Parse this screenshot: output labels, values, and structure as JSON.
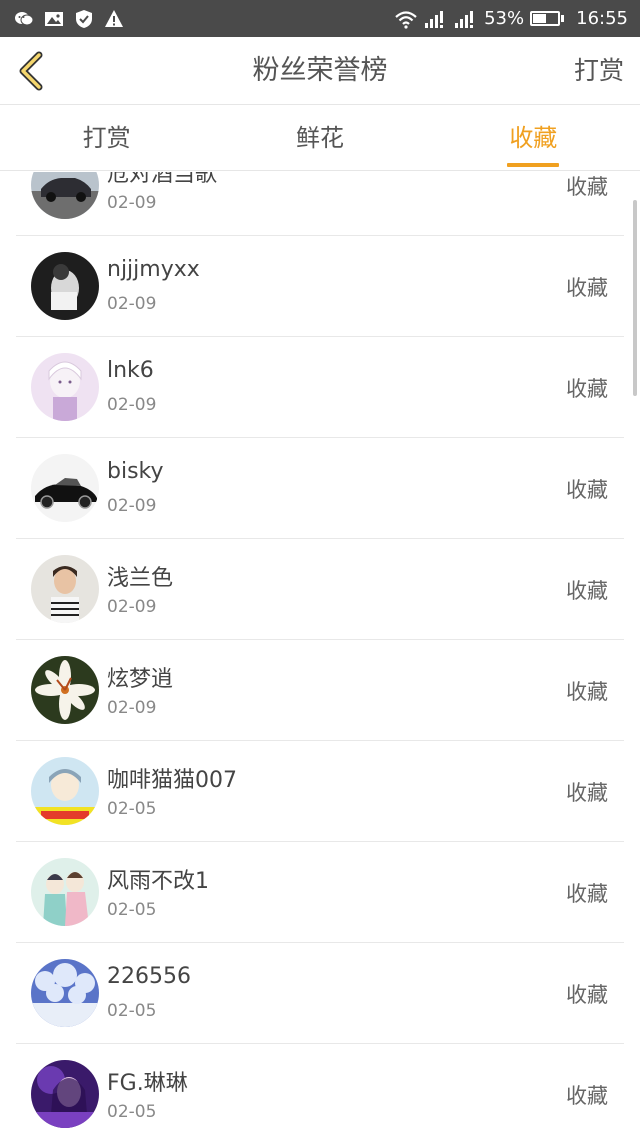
{
  "status_bar": {
    "battery": "53%",
    "battery_level": 0.53,
    "time": "16:55",
    "icons_left": [
      "wechat-icon",
      "image-icon",
      "shield-icon",
      "warning-icon"
    ],
    "icons_right": [
      "wifi-icon",
      "signal-icon",
      "signal-icon",
      "battery-icon"
    ]
  },
  "header": {
    "title": "粉丝荣誉榜",
    "right_action": "打赏"
  },
  "tabs": [
    {
      "label": "打赏",
      "active": false
    },
    {
      "label": "鲜花",
      "active": false
    },
    {
      "label": "收藏",
      "active": true
    }
  ],
  "colors": {
    "accent": "#f0a020",
    "status_bar": "#4a4a4a",
    "text": "#555555"
  },
  "list": [
    {
      "name": "危对酒当歌",
      "date": "02-09",
      "action": "收藏",
      "avatar": "car-photo"
    },
    {
      "name": "njjjmyxx",
      "date": "02-09",
      "action": "收藏",
      "avatar": "dark-photo"
    },
    {
      "name": "lnk6",
      "date": "02-09",
      "action": "收藏",
      "avatar": "anime-portrait"
    },
    {
      "name": "bisky",
      "date": "02-09",
      "action": "收藏",
      "avatar": "black-car"
    },
    {
      "name": "浅兰色",
      "date": "02-09",
      "action": "收藏",
      "avatar": "person-photo"
    },
    {
      "name": "炫梦逍",
      "date": "02-09",
      "action": "收藏",
      "avatar": "lily-flower"
    },
    {
      "name": "咖啡猫猫007",
      "date": "02-05",
      "action": "收藏",
      "avatar": "cartoon-photo"
    },
    {
      "name": "风雨不改1",
      "date": "02-05",
      "action": "收藏",
      "avatar": "anime-couple"
    },
    {
      "name": "226556",
      "date": "02-05",
      "action": "收藏",
      "avatar": "snowy-trees"
    },
    {
      "name": "FG.琳琳",
      "date": "02-05",
      "action": "收藏",
      "avatar": "purple-portrait"
    }
  ]
}
